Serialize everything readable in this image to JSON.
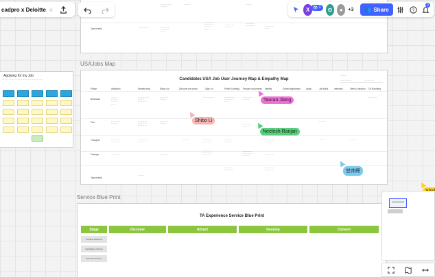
{
  "toolbar": {
    "board_title": "cadpro x Deloitte",
    "undo_icon": "undo-icon",
    "redo_icon": "redo-icon",
    "share_label": "Share",
    "reaction_count": "1",
    "more_collaborators": "+3",
    "avatar_initial": "X",
    "notifications_badge": "2"
  },
  "frames": {
    "usajobs_label": "USAJobs Map",
    "journey_title": "Candidates USA Job User Journey Map & Empathy Map",
    "service_label": "Service Blue Print",
    "blueprint_title": "TA Experience Service Blue Print",
    "left_frame_title": "Applying for my Job"
  },
  "journey": {
    "columns": [
      "Phase",
      "Attraction",
      "Researching",
      "Stand out",
      "Discover the portal",
      "Sign / In",
      "Profile Creating",
      "Prepare documents",
      "Identify",
      "Submit application",
      "Apply",
      "Job Bank",
      "Interview",
      "Offer & decision",
      "On Boarding"
    ],
    "rows": [
      "Behaviors",
      "Pain",
      "Thoughts",
      "Feelings",
      "Opportunity"
    ]
  },
  "blueprint": {
    "stages": [
      "Stage",
      "Discover",
      "Attract",
      "Develop",
      "Convert"
    ],
    "lanes": [
      "Physical Evidence",
      "Candidates Actions",
      "Recruiter Actions"
    ]
  },
  "cursors": [
    {
      "name": "Taoran Jiang",
      "color": "#f26fd8"
    },
    {
      "name": "Shibo Li",
      "color": "#f7b3b3"
    },
    {
      "name": "Neelesh Ranjan",
      "color": "#56d07a"
    },
    {
      "name": "甘帅辉",
      "color": "#7ccaf0"
    },
    {
      "name": "Shirle",
      "color": "#ffd02b"
    }
  ],
  "top_frame": {
    "row_label": "Opportunity"
  }
}
